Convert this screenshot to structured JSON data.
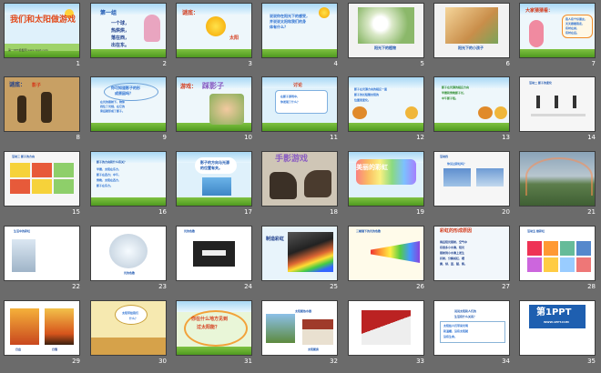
{
  "slides": [
    {
      "n": "1",
      "texts": [
        {
          "t": "我们和太阳做游戏",
          "c": "#e24a1a",
          "s": 9,
          "x": 6,
          "y": 14
        }
      ],
      "foot": "第一PPT模板网 www.1ppt.com",
      "bg": "#dff1fb",
      "kind": "title"
    },
    {
      "n": "2",
      "texts": [
        {
          "t": "第一组",
          "c": "#1e57b0",
          "s": 6,
          "x": 10,
          "y": 8
        },
        {
          "t": "一个球，",
          "c": "#1e3f8c",
          "s": 5,
          "x": 22,
          "y": 20
        },
        {
          "t": "热烘烘，",
          "c": "#1e3f8c",
          "s": 5,
          "x": 22,
          "y": 28
        },
        {
          "t": "落在西，",
          "c": "#1e3f8c",
          "s": 5,
          "x": 22,
          "y": 36
        },
        {
          "t": "出在东。",
          "c": "#1e3f8c",
          "s": 5,
          "x": 22,
          "y": 44
        }
      ],
      "bg": "#eef7fb",
      "kind": "girl"
    },
    {
      "n": "3",
      "texts": [
        {
          "t": "谜底：",
          "c": "#d43a1a",
          "s": 6,
          "x": 6,
          "y": 8
        },
        {
          "t": "太阳",
          "c": "#d43a1a",
          "s": 5,
          "x": 58,
          "y": 36
        }
      ],
      "bg": "#eef7fb",
      "kind": "sun"
    },
    {
      "n": "4",
      "texts": [
        {
          "t": "说说你在阳光下的感受，",
          "c": "#2a6fd1",
          "s": 4,
          "x": 8,
          "y": 12
        },
        {
          "t": "并说说太阳和我们的身",
          "c": "#2a6fd1",
          "s": 4,
          "x": 8,
          "y": 18
        },
        {
          "t": "体有什么？",
          "c": "#2a6fd1",
          "s": 4,
          "x": 8,
          "y": 24
        }
      ],
      "bg": "#eef7fb",
      "kind": "sunface"
    },
    {
      "n": "5",
      "texts": [
        {
          "t": "阳光下的植物",
          "c": "#1e57b0",
          "s": 4,
          "x": 28,
          "y": 47
        }
      ],
      "bg": "#f2f2f2",
      "kind": "flower"
    },
    {
      "n": "6",
      "texts": [
        {
          "t": "阳光下的小孩子",
          "c": "#1e57b0",
          "s": 4,
          "x": 26,
          "y": 47
        }
      ],
      "bg": "#f2f2f2",
      "kind": "child"
    },
    {
      "n": "7",
      "texts": [
        {
          "t": "大家猜猜看：",
          "c": "#d43a1a",
          "s": 5,
          "x": 6,
          "y": 6
        },
        {
          "t": "我人有个好朋友，",
          "c": "#2a6fd1",
          "s": 3,
          "x": 50,
          "y": 16
        },
        {
          "t": "天天跟着我走，",
          "c": "#2a6fd1",
          "s": 3,
          "x": 50,
          "y": 21
        },
        {
          "t": "有时在前，",
          "c": "#2a6fd1",
          "s": 3,
          "x": 50,
          "y": 26
        },
        {
          "t": "有时在后。",
          "c": "#2a6fd1",
          "s": 3,
          "x": 50,
          "y": 31
        }
      ],
      "bg": "#eef7fb",
      "kind": "girl2"
    },
    {
      "n": "8",
      "texts": [
        {
          "t": "谜底：",
          "c": "#1e3f8c",
          "s": 6,
          "x": 5,
          "y": 6
        },
        {
          "t": "影子",
          "c": "#d43a1a",
          "s": 5,
          "x": 30,
          "y": 7
        }
      ],
      "bg": "#c8a064",
      "kind": "shadow"
    },
    {
      "n": "9",
      "texts": [
        {
          "t": "你可知道影子的形",
          "c": "#2a6fd1",
          "s": 4,
          "x": 22,
          "y": 10
        },
        {
          "t": "成原因吗？",
          "c": "#2a6fd1",
          "s": 4,
          "x": 26,
          "y": 16
        },
        {
          "t": "在光的照射下，物体",
          "c": "#2a6fd1",
          "s": 3,
          "x": 10,
          "y": 26
        },
        {
          "t": "挡住了光线，在它的",
          "c": "#2a6fd1",
          "s": 3,
          "x": 10,
          "y": 31
        },
        {
          "t": "背后就形成了影子。",
          "c": "#2a6fd1",
          "s": 3,
          "x": 10,
          "y": 36
        }
      ],
      "bg": "#eef7fb",
      "kind": "bubble"
    },
    {
      "n": "10",
      "texts": [
        {
          "t": "游戏：",
          "c": "#d43a1a",
          "s": 6,
          "x": 4,
          "y": 8
        },
        {
          "t": "踩影子",
          "c": "#8a5cc2",
          "s": 8,
          "x": 28,
          "y": 6
        }
      ],
      "bg": "#eef7fb",
      "kind": "kids"
    },
    {
      "n": "11",
      "texts": [
        {
          "t": "讨论",
          "c": "#d43a1a",
          "s": 5,
          "x": 34,
          "y": 7
        },
        {
          "t": "在影子游戏中，",
          "c": "#2a6fd1",
          "s": 3,
          "x": 20,
          "y": 20
        },
        {
          "t": "你发现了什么？",
          "c": "#2a6fd1",
          "s": 3,
          "x": 20,
          "y": 26
        }
      ],
      "bg": "#dff1fb",
      "kind": "board"
    },
    {
      "n": "12",
      "texts": [
        {
          "t": "影子在光源方向的相反一面",
          "c": "#2a6fd1",
          "s": 3,
          "x": 6,
          "y": 12
        },
        {
          "t": "影子的长短随太阳的",
          "c": "#2a6fd1",
          "s": 3,
          "x": 6,
          "y": 18
        },
        {
          "t": "位置而变化。",
          "c": "#2a6fd1",
          "s": 3,
          "x": 6,
          "y": 24
        }
      ],
      "bg": "#eef7fb",
      "kind": "bear"
    },
    {
      "n": "13",
      "texts": [
        {
          "t": "影子在光源的相反方向",
          "c": "#2a8a2a",
          "s": 3,
          "x": 8,
          "y": 10
        },
        {
          "t": "早晨和傍晚影子长，",
          "c": "#2a8a2a",
          "s": 3,
          "x": 8,
          "y": 16
        },
        {
          "t": "中午影子短。",
          "c": "#2a8a2a",
          "s": 3,
          "x": 8,
          "y": 22
        }
      ],
      "bg": "#eef7fb",
      "kind": "bear2"
    },
    {
      "n": "14",
      "texts": [
        {
          "t": "活动二 影子的变化",
          "c": "#1e57b0",
          "s": 3,
          "x": 10,
          "y": 5
        }
      ],
      "bg": "#f6f6f6",
      "kind": "figures"
    },
    {
      "n": "15",
      "texts": [
        {
          "t": "活动三 影子的方向",
          "c": "#1e57b0",
          "s": 3,
          "x": 8,
          "y": 4
        }
      ],
      "bg": "#f6f6f6",
      "kind": "table"
    },
    {
      "n": "16",
      "texts": [
        {
          "t": "影子的方向和什么有关？",
          "c": "#1e57b0",
          "s": 3,
          "x": 6,
          "y": 10
        },
        {
          "t": "早晨，太阳在东方，",
          "c": "#2a6fd1",
          "s": 3,
          "x": 6,
          "y": 18
        },
        {
          "t": "影子在西方；中午，",
          "c": "#2a6fd1",
          "s": 3,
          "x": 6,
          "y": 24
        },
        {
          "t": "傍晚，太阳在西方，",
          "c": "#2a6fd1",
          "s": 3,
          "x": 6,
          "y": 30
        },
        {
          "t": "影子在东方。",
          "c": "#2a6fd1",
          "s": 3,
          "x": 6,
          "y": 36
        }
      ],
      "bg": "#eef7fb",
      "kind": "textgrass"
    },
    {
      "n": "17",
      "texts": [
        {
          "t": "影子的方向与光源",
          "c": "#1e57b0",
          "s": 4,
          "x": 26,
          "y": 10
        },
        {
          "t": "的位置有关。",
          "c": "#1e57b0",
          "s": 4,
          "x": 26,
          "y": 16
        }
      ],
      "bg": "#dff1fb",
      "kind": "cloud"
    },
    {
      "n": "18",
      "texts": [
        {
          "t": "手影游戏",
          "c": "#8a5cc2",
          "s": 9,
          "x": 14,
          "y": 4
        }
      ],
      "bg": "#cfc6b6",
      "kind": "hands"
    },
    {
      "n": "19",
      "texts": [
        {
          "t": "美丽的彩虹",
          "c": "#ffffff",
          "s": 7,
          "x": 8,
          "y": 14
        }
      ],
      "bg": "#dff1fb",
      "kind": "rainbowtitle"
    },
    {
      "n": "20",
      "texts": [
        {
          "t": "活动四",
          "c": "#1e57b0",
          "s": 3,
          "x": 6,
          "y": 4
        },
        {
          "t": "你见过彩虹吗？",
          "c": "#2a6fd1",
          "s": 3,
          "x": 14,
          "y": 12
        }
      ],
      "bg": "#f6f6f6",
      "kind": "rainbowpic"
    },
    {
      "n": "21",
      "texts": [],
      "bg": "#8fa6b8",
      "kind": "landscape"
    },
    {
      "n": "22",
      "texts": [
        {
          "t": "生活中的彩虹",
          "c": "#1e57b0",
          "s": 3,
          "x": 10,
          "y": 4
        }
      ],
      "bg": "#ffffff",
      "kind": "bubbles"
    },
    {
      "n": "23",
      "texts": [
        {
          "t": "光的色散",
          "c": "#1e57b0",
          "s": 3,
          "x": 36,
          "y": 50
        }
      ],
      "bg": "#ffffff",
      "kind": "jelly"
    },
    {
      "n": "24",
      "texts": [
        {
          "t": "光的色散",
          "c": "#1e57b0",
          "s": 3,
          "x": 8,
          "y": 4
        }
      ],
      "bg": "#ffffff",
      "kind": "prism"
    },
    {
      "n": "25",
      "texts": [
        {
          "t": "制造彩虹",
          "c": "#1e3f8c",
          "s": 5,
          "x": 4,
          "y": 12
        }
      ],
      "bg": "#e8f4fb",
      "kind": "prism2"
    },
    {
      "n": "26",
      "texts": [
        {
          "t": "三棱镜下的光的色散",
          "c": "#1e57b0",
          "s": 3,
          "x": 8,
          "y": 4
        }
      ],
      "bg": "#fffbea",
      "kind": "spectrum"
    },
    {
      "n": "27",
      "texts": [
        {
          "t": "彩虹的形成原因",
          "c": "#d43a1a",
          "s": 5,
          "x": 6,
          "y": 3
        },
        {
          "t": "雨后阳光照射，空气中",
          "c": "#1e3f8c",
          "s": 3,
          "x": 6,
          "y": 16
        },
        {
          "t": "有很多小水滴，阳光",
          "c": "#1e3f8c",
          "s": 3,
          "x": 6,
          "y": 22
        },
        {
          "t": "照射到小水滴上发生",
          "c": "#1e3f8c",
          "s": 3,
          "x": 6,
          "y": 28
        },
        {
          "t": "折射，分解成红、橙",
          "c": "#1e3f8c",
          "s": 3,
          "x": 6,
          "y": 34
        },
        {
          "t": "黄、绿、蓝、靛、紫。",
          "c": "#1e3f8c",
          "s": 3,
          "x": 6,
          "y": 40
        }
      ],
      "bg": "#f2f7fb",
      "kind": "textonly"
    },
    {
      "n": "28",
      "texts": [
        {
          "t": "活动五 做彩虹",
          "c": "#1e57b0",
          "s": 3,
          "x": 8,
          "y": 4
        }
      ],
      "bg": "#ffffff",
      "kind": "colorgrid"
    },
    {
      "n": "29",
      "texts": [
        {
          "t": "日出",
          "c": "#1e3f8c",
          "s": 3,
          "x": 12,
          "y": 52
        },
        {
          "t": "日落",
          "c": "#1e3f8c",
          "s": 3,
          "x": 52,
          "y": 52
        }
      ],
      "bg": "#ffffff",
      "kind": "sunsets"
    },
    {
      "n": "30",
      "texts": [
        {
          "t": "太阳带给我们",
          "c": "#2a6fd1",
          "s": 3,
          "x": 34,
          "y": 12
        },
        {
          "t": "什么？",
          "c": "#2a6fd1",
          "s": 3,
          "x": 42,
          "y": 18
        }
      ],
      "bg": "#f6e9b0",
      "kind": "desert"
    },
    {
      "n": "31",
      "texts": [
        {
          "t": "你在什么地方见到",
          "c": "#d43a1a",
          "s": 5,
          "x": 16,
          "y": 18
        },
        {
          "t": "过太阳能？",
          "c": "#d43a1a",
          "s": 5,
          "x": 22,
          "y": 27
        }
      ],
      "bg": "#e9f6d8",
      "kind": "question"
    },
    {
      "n": "32",
      "texts": [
        {
          "t": "太阳能热水器",
          "c": "#1e57b0",
          "s": 3,
          "x": 36,
          "y": 10
        },
        {
          "t": "太阳能房",
          "c": "#1e57b0",
          "s": 3,
          "x": 50,
          "y": 52
        }
      ],
      "bg": "#ffffff",
      "kind": "houses"
    },
    {
      "n": "33",
      "texts": [],
      "bg": "#ffffff",
      "kind": "roof"
    },
    {
      "n": "34",
      "texts": [
        {
          "t": "说说太阳和人们的",
          "c": "#1e57b0",
          "s": 3,
          "x": 22,
          "y": 10
        },
        {
          "t": "生活有什么关系？",
          "c": "#1e57b0",
          "s": 3,
          "x": 22,
          "y": 16
        },
        {
          "t": "太阳给人们带来光明",
          "c": "#2a6fd1",
          "s": 3,
          "x": 10,
          "y": 26
        },
        {
          "t": "和温暖，没有太阳就",
          "c": "#2a6fd1",
          "s": 3,
          "x": 10,
          "y": 32
        },
        {
          "t": "没有生命。",
          "c": "#2a6fd1",
          "s": 3,
          "x": 10,
          "y": 38
        }
      ],
      "bg": "#ffffff",
      "kind": "textbox"
    },
    {
      "n": "35",
      "texts": [
        {
          "t": "第1PPT",
          "c": "#ffffff",
          "s": 10,
          "x": 18,
          "y": 8
        },
        {
          "t": "WWW.1PPT.COM",
          "c": "#ffffff",
          "s": 3,
          "x": 26,
          "y": 22
        }
      ],
      "bg": "#ffffff",
      "kind": "logo"
    }
  ]
}
